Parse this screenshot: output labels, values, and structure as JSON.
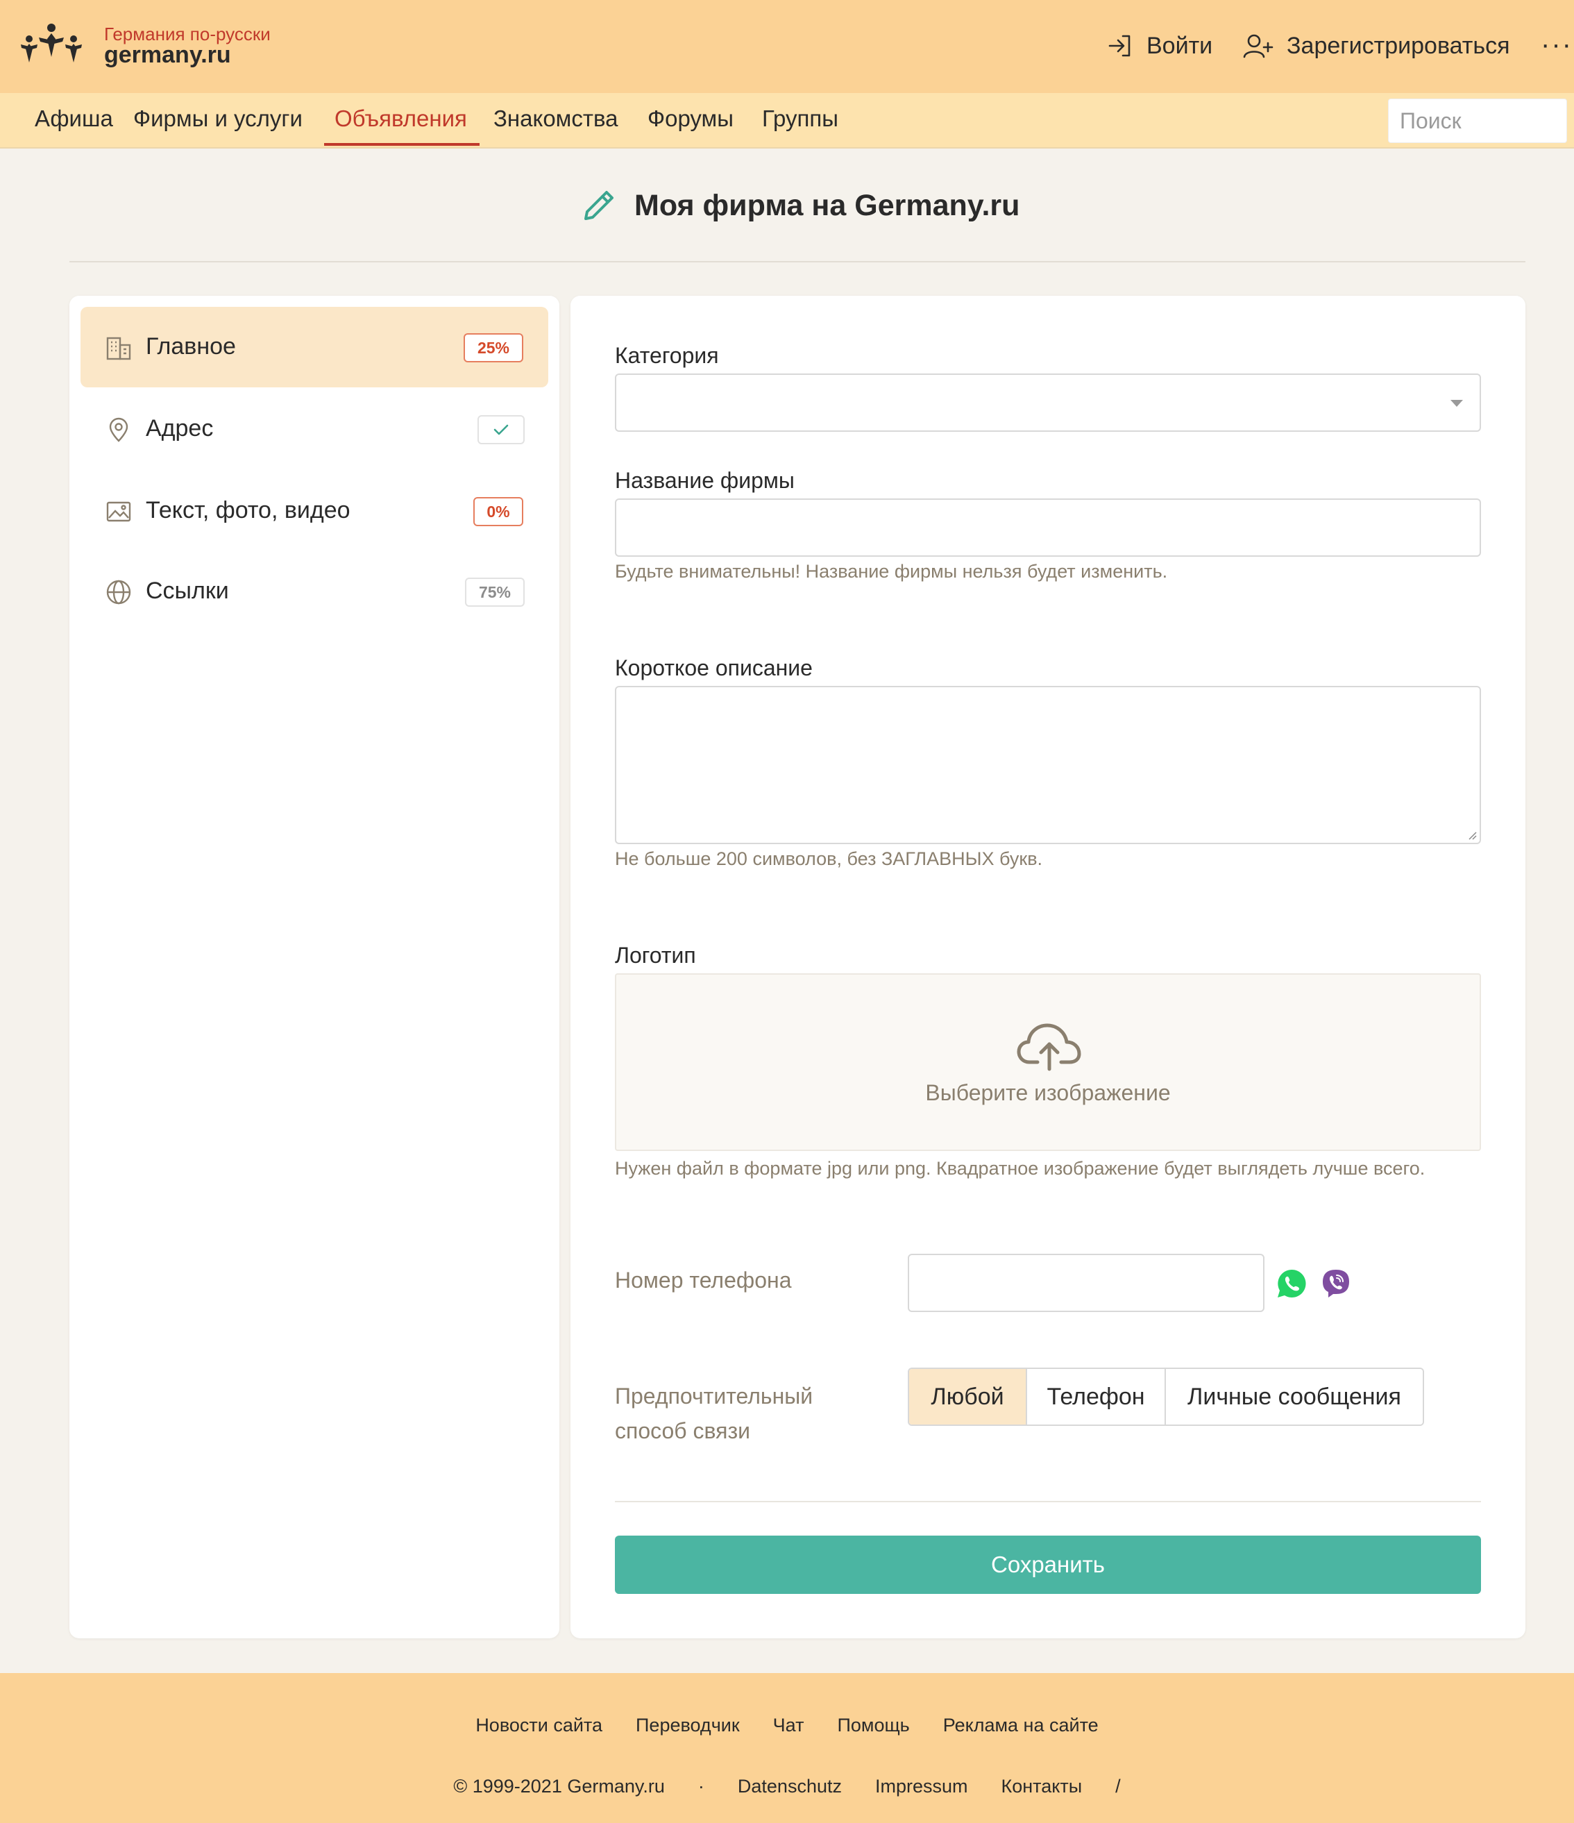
{
  "header": {
    "logo_tagline": "Германия по-русски",
    "logo_name": "germany.ru",
    "login_label": "Войти",
    "register_label": "Зарегистрироваться",
    "more_label": "···"
  },
  "nav": {
    "items": [
      {
        "label": "Афиша"
      },
      {
        "label": "Фирмы и услуги"
      },
      {
        "label": "Объявления",
        "active": true
      },
      {
        "label": "Знакомства"
      },
      {
        "label": "Форумы"
      },
      {
        "label": "Группы"
      }
    ],
    "search_placeholder": "Поиск"
  },
  "page": {
    "title": "Моя фирма на Germany.ru"
  },
  "sidebar": {
    "items": [
      {
        "label": "Главное",
        "badge": "25%",
        "badge_type": "red",
        "icon": "building-icon",
        "active": true
      },
      {
        "label": "Адрес",
        "badge": "",
        "badge_type": "check",
        "icon": "location-pin-icon"
      },
      {
        "label": "Текст, фото, видео",
        "badge": "0%",
        "badge_type": "red",
        "icon": "image-icon"
      },
      {
        "label": "Ссылки",
        "badge": "75%",
        "badge_type": "grey",
        "icon": "globe-icon"
      }
    ]
  },
  "form": {
    "category_label": "Категория",
    "category_value": "",
    "company_name_label": "Название фирмы",
    "company_name_value": "",
    "company_name_hint": "Будьте внимательны! Название фирмы нельзя будет изменить.",
    "short_desc_label": "Короткое описание",
    "short_desc_value": "",
    "short_desc_hint": "Не больше 200 символов, без ЗАГЛАВНЫХ букв.",
    "logo_label": "Логотип",
    "logo_upload_text": "Выберите изображение",
    "logo_hint": "Нужен файл в формате jpg или png. Квадратное изображение будет выглядеть лучше всего.",
    "phone_label": "Номер телефона",
    "phone_value": "",
    "contact_pref_label": "Предпочтительный способ связи",
    "contact_options": [
      {
        "label": "Любой",
        "selected": true
      },
      {
        "label": "Телефон",
        "selected": false
      },
      {
        "label": "Личные сообщения",
        "selected": false
      }
    ],
    "save_label": "Сохранить"
  },
  "footer": {
    "links_row1": [
      "Новости сайта",
      "Переводчик",
      "Чат",
      "Помощь",
      "Реклама на сайте"
    ],
    "copyright": "© 1999-2021 Germany.ru",
    "separator": "·",
    "links_row2": [
      "Datenschutz",
      "Impressum",
      "Контакты"
    ],
    "trailing": "/"
  },
  "colors": {
    "header_bg": "#fbd295",
    "nav_bg": "#fde3ae",
    "accent_red": "#c0392b",
    "save_button": "#4bb5a2",
    "sidebar_active": "#fbe7c8"
  }
}
